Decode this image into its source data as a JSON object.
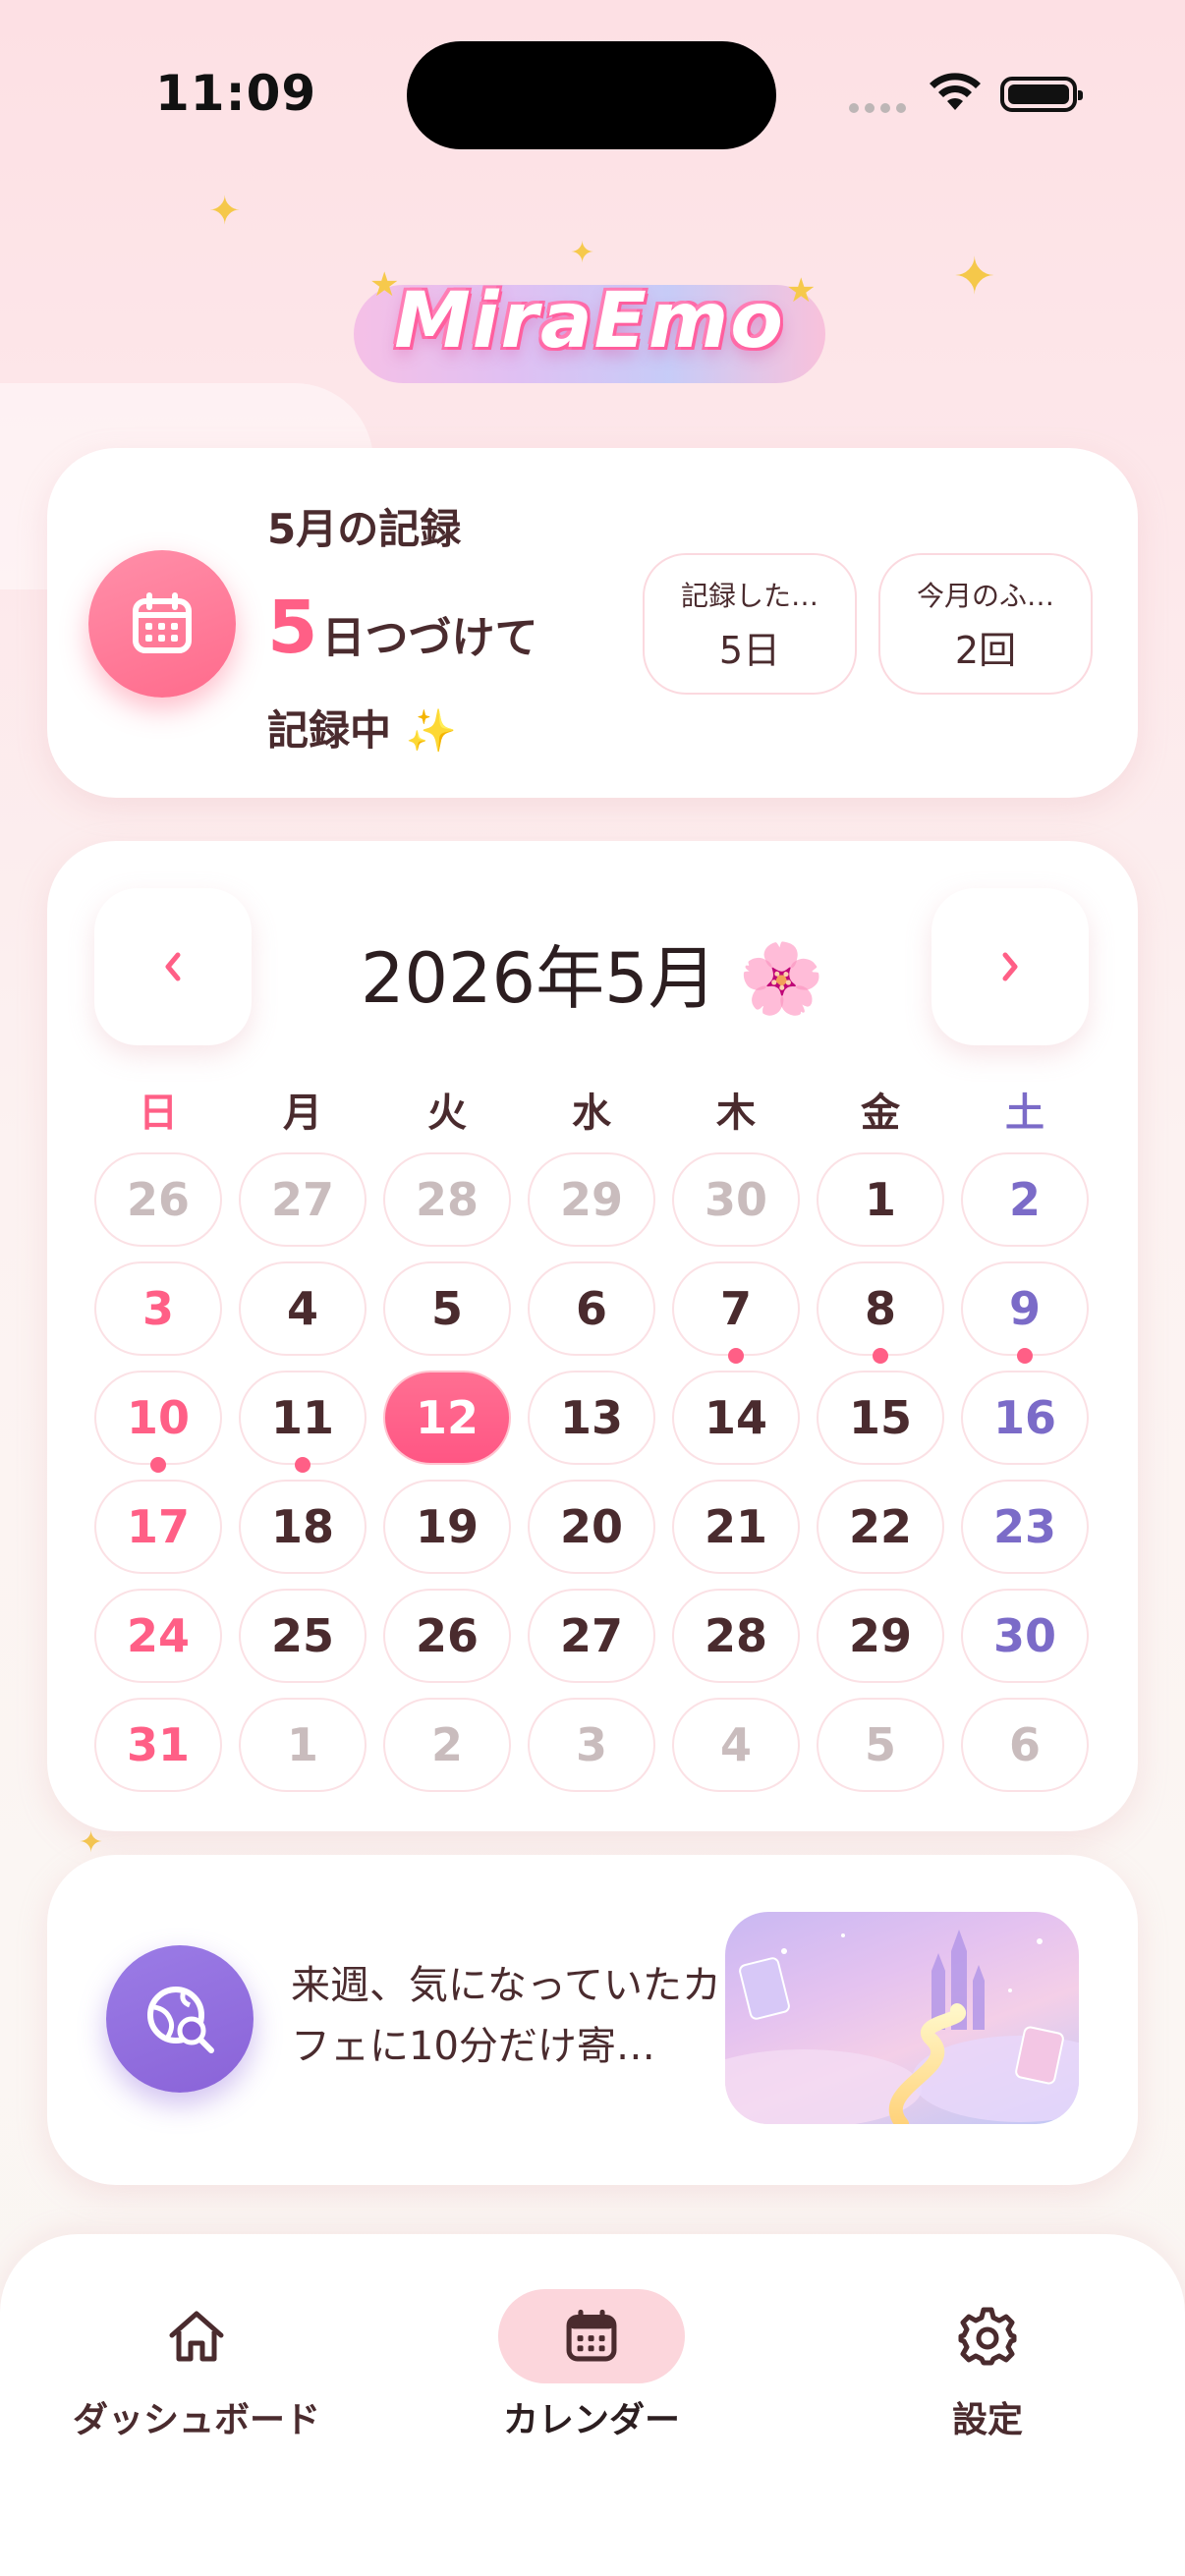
{
  "status_bar": {
    "time": "11:09"
  },
  "app": {
    "logo_text": "MiraEmo"
  },
  "record_card": {
    "title": "5月の記録",
    "streak_number": "5",
    "streak_suffix": "日つづけて",
    "streak_sub": "記録中 ✨",
    "stats": [
      {
        "label": "記録した…",
        "value": "5日"
      },
      {
        "label": "今月のふ…",
        "value": "2回"
      }
    ]
  },
  "calendar": {
    "title": "2026年5月",
    "title_emoji": "🌸",
    "prev_label": "‹",
    "next_label": "›",
    "weekdays": [
      "日",
      "月",
      "火",
      "水",
      "木",
      "金",
      "土"
    ],
    "rows": [
      [
        "26",
        "27",
        "28",
        "29",
        "30",
        "1",
        "2"
      ],
      [
        "3",
        "4",
        "5",
        "6",
        "7",
        "8",
        "9"
      ],
      [
        "10",
        "11",
        "12",
        "13",
        "14",
        "15",
        "16"
      ],
      [
        "17",
        "18",
        "19",
        "20",
        "21",
        "22",
        "23"
      ],
      [
        "24",
        "25",
        "26",
        "27",
        "28",
        "29",
        "30"
      ],
      [
        "31",
        "1",
        "2",
        "3",
        "4",
        "5",
        "6"
      ]
    ],
    "today": "12",
    "marked_days": [
      "7",
      "8",
      "9",
      "10",
      "11"
    ]
  },
  "future_card": {
    "text": "来週、気になっていたカフェに10分だけ寄…"
  },
  "tab_bar": {
    "items": [
      {
        "label": "ダッシュボード",
        "icon": "home-icon"
      },
      {
        "label": "カレンダー",
        "icon": "calendar-icon",
        "active": true
      },
      {
        "label": "設定",
        "icon": "gear-icon"
      }
    ]
  },
  "colors": {
    "accent": "#ff5f86",
    "saturday": "#7b6bc8",
    "muted": "#c9bcbd",
    "text": "#4a2b2e"
  }
}
